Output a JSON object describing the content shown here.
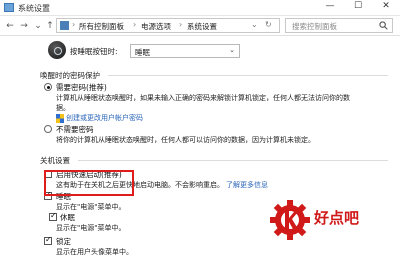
{
  "window": {
    "title": "系统设置",
    "minimize": "—",
    "maximize": "☐",
    "close": "✕"
  },
  "address": {
    "breadcrumbs": [
      "所有控制面板",
      "电源选项",
      "系统设置"
    ],
    "search_placeholder": "搜索控制面板"
  },
  "power_button": {
    "label": "按睡眠按钮时:",
    "value": "睡眠"
  },
  "wake_password": {
    "section_title": "唤醒时的密码保护",
    "require_title": "需要密码(推荐)",
    "require_desc_1": "计算机从睡眠状态唤醒时，如果未输入正确的密码来解锁计算机锁定，任何人都无法访问你的数",
    "require_desc_2": "据。",
    "require_link": "创建或更改用户帐户密码",
    "no_require_title": "不需要密码",
    "no_require_desc": "将你的计算机从睡眠状态唤醒时，任何人都可以访问你的数据，因为计算机未锁定。"
  },
  "shutdown": {
    "section_title": "关机设置",
    "fast_startup_title": "启用快速启动(推荐)",
    "fast_startup_desc": "这有助于在关机之后更快地启动电脑。不会影响重启。",
    "fast_startup_link": "了解更多信息",
    "sleep_title": "睡眠",
    "sleep_desc": "显示在\"电源\"菜单中。",
    "hibernate_title": "休眠",
    "hibernate_desc": "显示在\"电源\"菜单中。",
    "lock_title": "锁定",
    "lock_desc": "显示在用户头像菜单中。"
  },
  "watermark": {
    "text": "好点吧"
  },
  "colors": {
    "link": "#2a66b9",
    "highlight": "#e01b1b",
    "watermark": "#d01919"
  }
}
